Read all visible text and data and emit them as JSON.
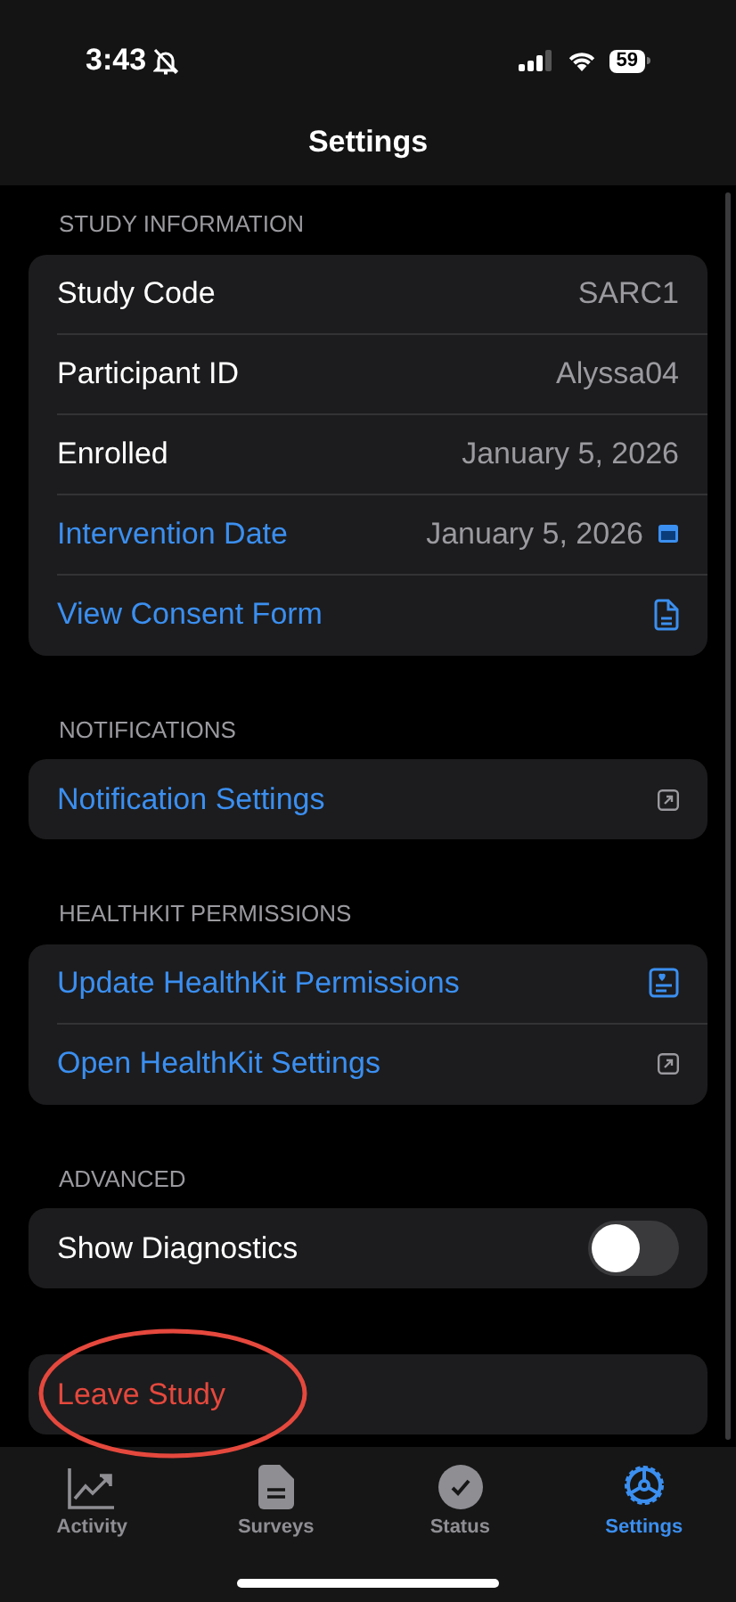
{
  "status_bar": {
    "time": "3:43",
    "battery": "59"
  },
  "title": "Settings",
  "sections": [
    {
      "header": "STUDY INFORMATION",
      "rows": [
        {
          "kind": "value",
          "label": "Study Code",
          "value": "SARC1"
        },
        {
          "kind": "value",
          "label": "Participant ID",
          "value": "Alyssa04"
        },
        {
          "kind": "value",
          "label": "Enrolled",
          "value": "January 5, 2026"
        },
        {
          "kind": "date",
          "label": "Intervention Date",
          "value": "January 5, 2026"
        },
        {
          "kind": "document",
          "label": "View Consent Form"
        }
      ]
    },
    {
      "header": "NOTIFICATIONS",
      "rows": [
        {
          "kind": "external",
          "label": "Notification Settings"
        }
      ]
    },
    {
      "header": "HEALTHKIT PERMISSIONS",
      "rows": [
        {
          "kind": "health",
          "label": "Update HealthKit Permissions"
        },
        {
          "kind": "external",
          "label": "Open HealthKit Settings"
        }
      ]
    },
    {
      "header": "ADVANCED",
      "rows": [
        {
          "kind": "toggle",
          "label": "Show Diagnostics",
          "on": false
        }
      ]
    },
    {
      "rows": [
        {
          "kind": "destructive",
          "label": "Leave Study",
          "circled": true
        }
      ]
    }
  ],
  "tabs": [
    {
      "kind": "activity",
      "label": "Activity",
      "selected": false
    },
    {
      "kind": "surveys",
      "label": "Surveys",
      "selected": false
    },
    {
      "kind": "status",
      "label": "Status",
      "selected": false
    },
    {
      "kind": "settings",
      "label": "Settings",
      "selected": true
    }
  ]
}
